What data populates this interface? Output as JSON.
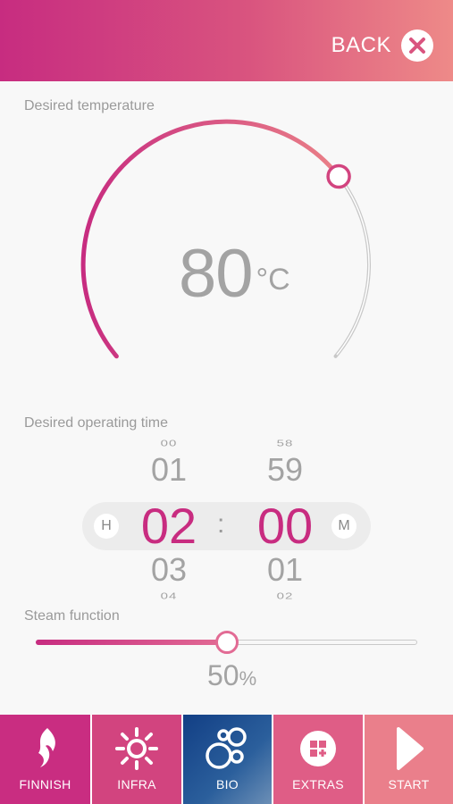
{
  "header": {
    "back_label": "BACK",
    "back_icon": "close-icon"
  },
  "temperature": {
    "label": "Desired temperature",
    "value": "80",
    "unit": "°C",
    "level_fraction": 0.7
  },
  "operating_time": {
    "label": "Desired operating time",
    "hours": {
      "tag": "H",
      "above_far": "00",
      "above": "01",
      "selected": "02",
      "below": "03",
      "below_far": "04"
    },
    "separator": ":",
    "minutes": {
      "tag": "M",
      "above_far": "58",
      "above": "59",
      "selected": "00",
      "below": "01",
      "below_far": "02"
    }
  },
  "steam": {
    "label": "Steam function",
    "value": "50",
    "unit": "%",
    "fraction": 0.5
  },
  "tabs": [
    {
      "label": "FINNISH",
      "icon": "flame-icon",
      "color": "#c92d81"
    },
    {
      "label": "INFRA",
      "icon": "sun-icon",
      "color": "#d2447f"
    },
    {
      "label": "BIO",
      "icon": "bubbles-icon",
      "color": "#1f4b8a",
      "selected": true
    },
    {
      "label": "EXTRAS",
      "icon": "grid-plus-icon",
      "color": "#df5d86"
    },
    {
      "label": "START",
      "icon": "play-icon",
      "color": "#ea7f8b"
    }
  ],
  "colors": {
    "accent": "#c82c80",
    "accent_light": "#ee8a88",
    "text_muted": "#9a9a9a"
  }
}
